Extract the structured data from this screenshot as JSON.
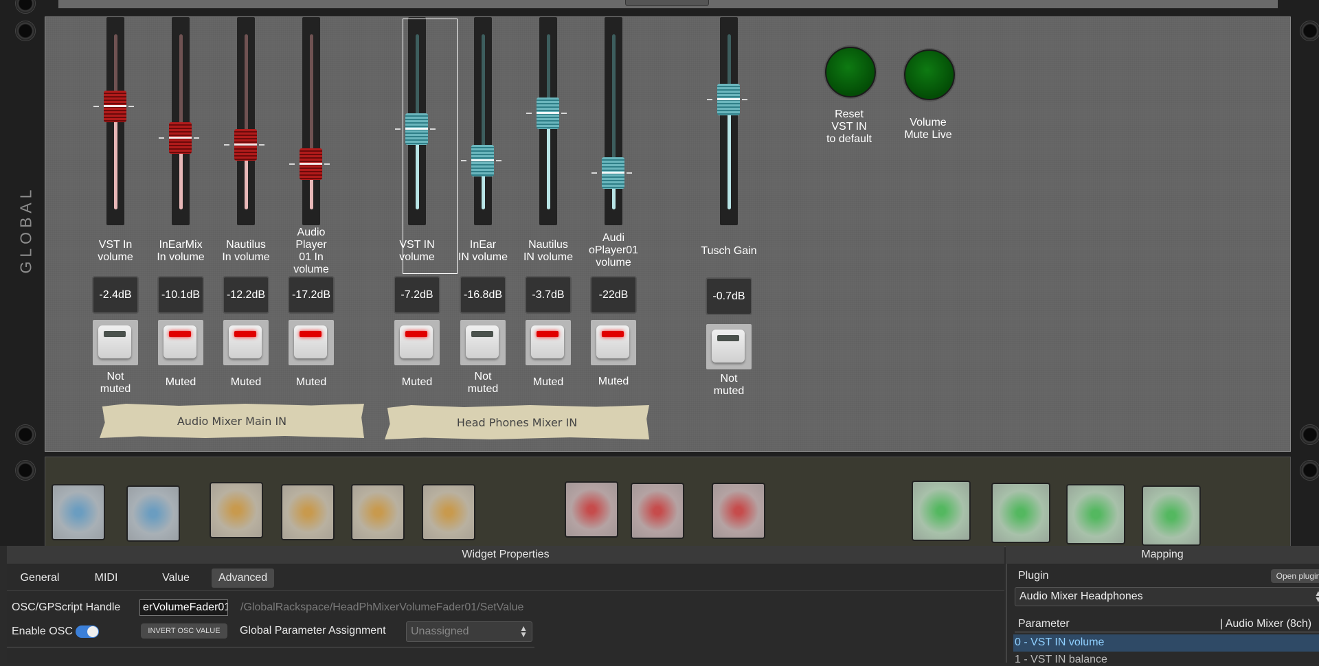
{
  "rack": {
    "side_label": "GLOBAL",
    "group_labels": [
      "Audio Mixer Main IN",
      "Head Phones Mixer IN"
    ],
    "faders": [
      {
        "label": "VST In\nvolume",
        "value": "-2.4dB",
        "level": 0.6,
        "color": "red",
        "mute_state": "Not\nmuted",
        "muted": false
      },
      {
        "label": "InEarMix\nIn volume",
        "value": "-10.1dB",
        "level": 0.42,
        "color": "red",
        "mute_state": "Muted",
        "muted": true
      },
      {
        "label": "Nautilus\nIn volume",
        "value": "-12.2dB",
        "level": 0.38,
        "color": "red",
        "mute_state": "Muted",
        "muted": true
      },
      {
        "label": "Audio\nPlayer\n01 In\nvolume",
        "value": "-17.2dB",
        "level": 0.27,
        "color": "red",
        "mute_state": "Muted",
        "muted": true
      },
      {
        "label": "VST IN\nvolume",
        "value": "-7.2dB",
        "level": 0.47,
        "color": "teal",
        "mute_state": "Muted",
        "muted": true,
        "selected": true
      },
      {
        "label": "InEar\nIN volume",
        "value": "-16.8dB",
        "level": 0.29,
        "color": "teal",
        "mute_state": "Not\nmuted",
        "muted": false
      },
      {
        "label": "Nautilus\nIN volume",
        "value": "-3.7dB",
        "level": 0.56,
        "color": "teal",
        "mute_state": "Muted",
        "muted": true
      },
      {
        "label": "Audi\noPlayer01\nvolume",
        "value": "-22dB",
        "level": 0.22,
        "color": "teal",
        "mute_state": "Muted",
        "muted": true
      },
      {
        "label": "Tusch Gain",
        "value": "-0.7dB",
        "level": 0.64,
        "color": "teal",
        "mute_state": "Not\nmuted",
        "muted": false
      }
    ],
    "indicators": [
      {
        "label": "Reset\nVST IN\nto default"
      },
      {
        "label": "Volume\nMute Live"
      }
    ],
    "pads": [
      "blue",
      "blue",
      "amber",
      "amber",
      "amber",
      "amber",
      "red",
      "red",
      "red",
      "green",
      "green",
      "green",
      "green"
    ]
  },
  "widget_properties": {
    "title": "Widget Properties",
    "tabs": [
      "General",
      "MIDI",
      "Value",
      "Advanced"
    ],
    "active_tab": "Advanced",
    "osc_handle_label": "OSC/GPScript Handle",
    "osc_handle_value": "erVolumeFader01",
    "osc_path": "/GlobalRackspace/HeadPhMixerVolumeFader01/SetValue",
    "enable_osc_label": "Enable OSC",
    "invert_osc_label": "INVERT OSC VALUE",
    "global_param_label": "Global Parameter Assignment",
    "global_param_value": "Unassigned"
  },
  "mapping": {
    "title": "Mapping",
    "plugin_label": "Plugin",
    "open_plugin": "Open plugin",
    "plugin_value": "Audio Mixer Headphones",
    "parameter_header": "Parameter",
    "parameter_header_right": "| Audio Mixer (8ch)",
    "params": [
      "0 - VST IN volume",
      "1 - VST IN balance"
    ]
  },
  "colors": {
    "accent": "#3b7fd8",
    "led_on": "#e00000",
    "panel": "#676767"
  }
}
